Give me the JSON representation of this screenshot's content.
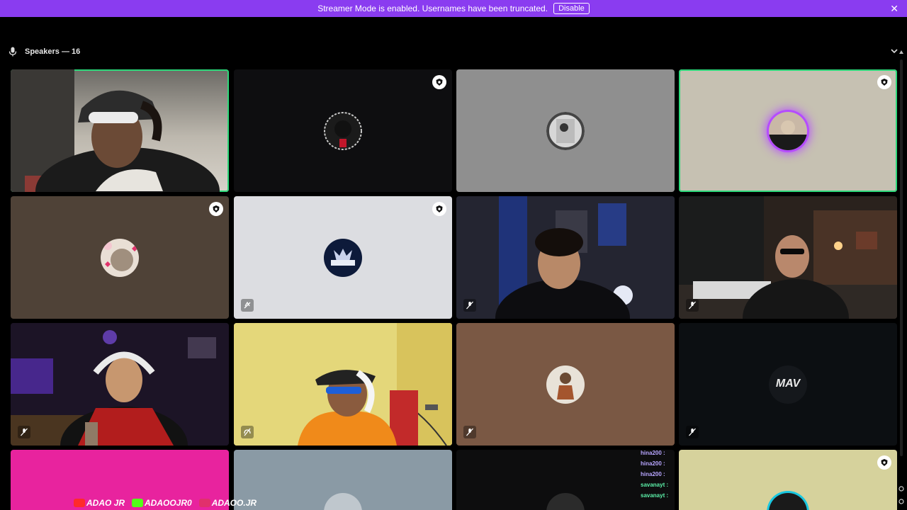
{
  "banner": {
    "message": "Streamer Mode is enabled. Usernames have been truncated.",
    "disable_label": "Disable",
    "close_glyph": "✕",
    "color": "#8a3cf0"
  },
  "section": {
    "title": "Speakers — 16"
  },
  "colors": {
    "speaking": "#2dd87a",
    "ring": "#b54cff"
  },
  "chat": {
    "lines": [
      {
        "user": "hina200 :",
        "color": "#b8a6ff"
      },
      {
        "user": "hina200 :",
        "color": "#b8a6ff"
      },
      {
        "user": "hina200 :",
        "color": "#b8a6ff"
      },
      {
        "user": "savanayt :",
        "color": "#5cf0a8"
      },
      {
        "user": "savanayt :",
        "color": "#5cf0a8"
      }
    ]
  },
  "socials": [
    {
      "label": "ADAO JR",
      "icon": "youtube-icon",
      "color": "#ff2a2a"
    },
    {
      "label": "ADAOOJR0",
      "icon": "kick-icon",
      "color": "#53fc18"
    },
    {
      "label": "ADAOO.JR",
      "icon": "instagram-icon",
      "color": "#e1306c"
    }
  ],
  "avatar_logo_text": "MAV"
}
